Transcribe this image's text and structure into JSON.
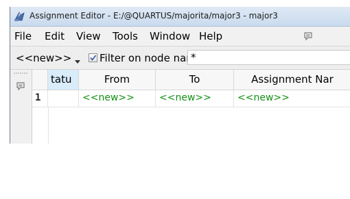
{
  "window": {
    "title": "Assignment Editor - E:/@QUARTUS/majorita/major3 - major3"
  },
  "menubar": {
    "items": [
      "File",
      "Edit",
      "View",
      "Tools",
      "Window",
      "Help"
    ]
  },
  "toolbar": {
    "node_combo": {
      "selected": "<<new>>"
    },
    "filter_checkbox": {
      "checked": true,
      "label": "Filter on node names:"
    },
    "filter_input": {
      "value": "*"
    }
  },
  "table": {
    "columns": [
      "tatu",
      "From",
      "To",
      "Assignment Nar"
    ],
    "rows": [
      {
        "row_number": "1",
        "status": "",
        "from": "<<new>>",
        "to": "<<new>>",
        "assignment_name": "<<new>>"
      }
    ]
  },
  "colors": {
    "new_entry_text": "#139013",
    "status_header_bg": "#d8ecfa",
    "title_bar": "#c9dbee"
  }
}
